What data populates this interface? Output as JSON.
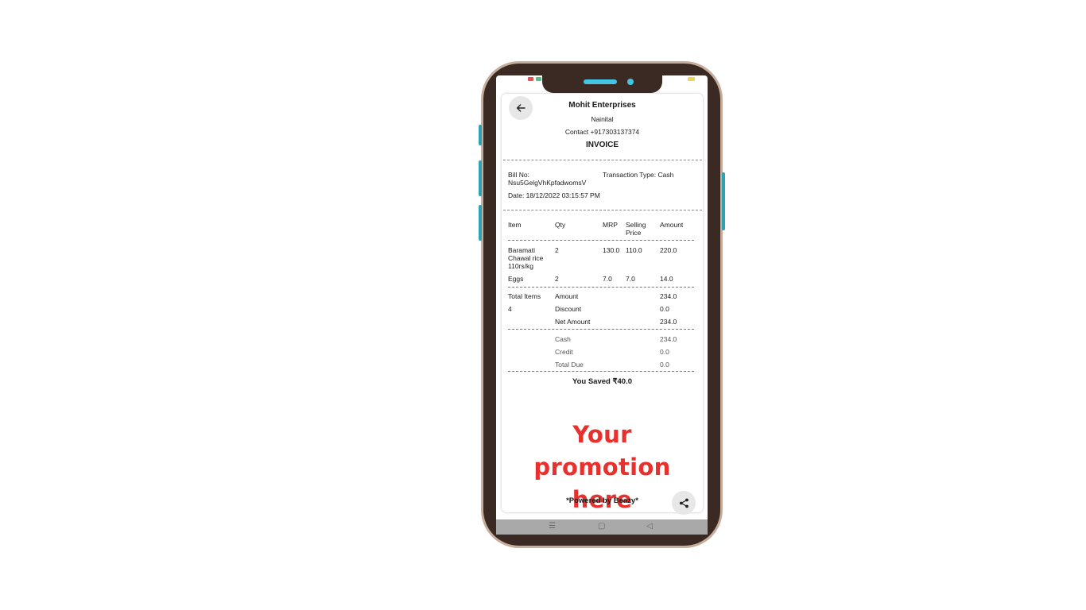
{
  "header": {
    "business_name": "Mohit Enterprises",
    "location": "Nainital",
    "contact": "Contact +917303137374",
    "doc_title": "INVOICE"
  },
  "bill": {
    "bill_no_label": "Bill No:",
    "bill_no": "Nsu5GelgVhKpfadwomsV",
    "transaction_type": "Transaction Type: Cash",
    "date": "Date: 18/12/2022 03:15:57 PM"
  },
  "table": {
    "headers": {
      "item": "Item",
      "qty": "Qty",
      "mrp": "MRP",
      "selling_price": "Selling Price",
      "amount": "Amount"
    },
    "rows": [
      {
        "item_lines": [
          "Baramati",
          "Chawal rice",
          "110rs/kg"
        ],
        "qty": "2",
        "mrp": "130.0",
        "selling_price": "110.0",
        "amount": "220.0"
      },
      {
        "item_lines": [
          "Eggs"
        ],
        "qty": "2",
        "mrp": "7.0",
        "selling_price": "7.0",
        "amount": "14.0"
      }
    ]
  },
  "totals": {
    "total_items_label": "Total Items",
    "total_items": "4",
    "amount_label": "Amount",
    "amount": "234.0",
    "discount_label": "Discount",
    "discount": "0.0",
    "net_amount_label": "Net Amount",
    "net_amount": "234.0"
  },
  "payment": {
    "cash_label": "Cash",
    "cash": "234.0",
    "credit_label": "Credit",
    "credit": "0.0",
    "total_due_label": "Total Due",
    "total_due": "0.0"
  },
  "savings": "You Saved ₹40.0",
  "promo": {
    "line1": "Your promotion",
    "line2": "here"
  },
  "footer": "*Powered by Beazy*",
  "icons": {
    "back": "arrow-left-icon",
    "share": "share-icon"
  },
  "colors": {
    "promo_text": "#e8302d",
    "phone_frame": "#3b2a24",
    "phone_rim": "#c7ad9c",
    "side_buttons": "#2aa4b4",
    "notch_accent": "#43c6e4"
  }
}
